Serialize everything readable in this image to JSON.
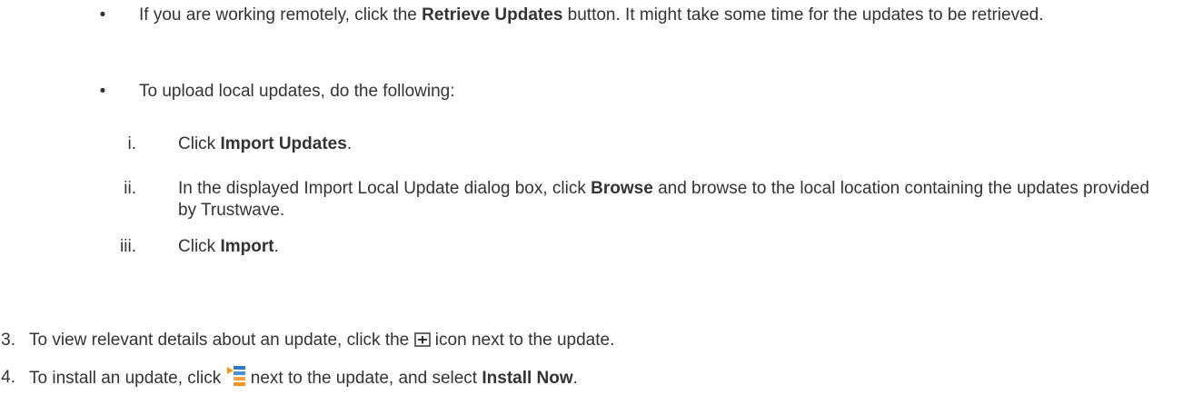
{
  "bullets": [
    {
      "marker": "•",
      "text_before": "If you are working remotely, click the ",
      "bold": "Retrieve Updates",
      "text_after": " button. It might take some time for the updates to be retrieved."
    },
    {
      "marker": "•",
      "text": "To upload local updates, do the following:"
    }
  ],
  "substeps": [
    {
      "marker": "i.",
      "text_before": "Click ",
      "bold": "Import Updates",
      "text_after": "."
    },
    {
      "marker": "ii.",
      "text_before": "In the displayed Import Local Update dialog box, click ",
      "bold": "Browse",
      "text_after": " and browse to the local location containing the updates provided by Trustwave."
    },
    {
      "marker": "iii.",
      "text_before": "Click ",
      "bold": "Import",
      "text_after": "."
    }
  ],
  "steps": [
    {
      "marker": "3.",
      "text_before": "To view relevant details about an update, click the ",
      "icon": "expand-plus-icon",
      "text_after": " icon next to the update."
    },
    {
      "marker": "4.",
      "text_before": "To install an update, click ",
      "icon": "actions-menu-icon",
      "text_middle": " next to the update, and select ",
      "bold": "Install Now",
      "text_after": "."
    }
  ],
  "colors": {
    "text": "#333333",
    "icon_orange": "#f7941d",
    "icon_blue": "#4a90d9"
  }
}
